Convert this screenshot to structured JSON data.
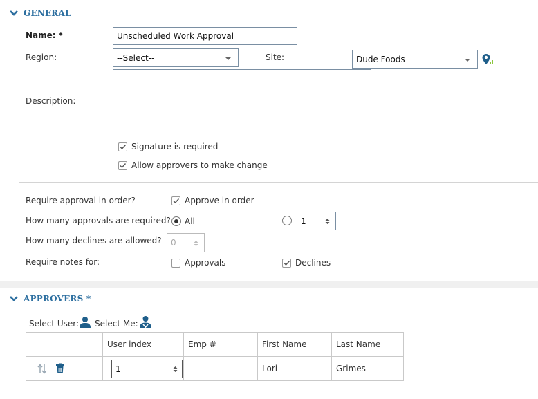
{
  "general": {
    "header": "GENERAL",
    "name_label": "Name: *",
    "name_value": "Unscheduled Work Approval",
    "region_label": "Region:",
    "region_value": "--Select--",
    "site_label": "Site:",
    "site_value": "Dude Foods",
    "description_label": "Description:",
    "description_value": "",
    "signature_label": "Signature is required",
    "signature_checked": true,
    "allow_change_label": "Allow approvers to make change",
    "allow_change_checked": true,
    "require_order_label": "Require approval in order?",
    "approve_in_order_label": "Approve in order",
    "approve_in_order_checked": true,
    "how_many_approvals_label": "How many approvals are required?",
    "approvals_all_label": "All",
    "approvals_selected": "All",
    "approvals_count_value": "1",
    "how_many_declines_label": "How many declines are allowed?",
    "declines_value": "0",
    "require_notes_label": "Require notes for:",
    "notes_approvals_label": "Approvals",
    "notes_approvals_checked": false,
    "notes_declines_label": "Declines",
    "notes_declines_checked": true
  },
  "approvers": {
    "header": "APPROVERS *",
    "select_user_label": "Select User:",
    "select_me_label": "Select Me:",
    "columns": [
      "",
      "User index",
      "Emp #",
      "First Name",
      "Last Name"
    ],
    "rows": [
      {
        "user_index": "1",
        "emp": "",
        "first_name": "Lori",
        "last_name": "Grimes"
      }
    ]
  },
  "colors": {
    "accent": "#2d6fa0",
    "icon_blue": "#1f5f8b",
    "location_green": "#8dc63f"
  },
  "icons": {
    "collapse": "chevron-down-icon",
    "site_location": "map-pin-icon",
    "select_user": "user-icon",
    "select_me": "user-self-icon",
    "reorder": "sort-arrows-icon",
    "delete": "trash-icon"
  }
}
